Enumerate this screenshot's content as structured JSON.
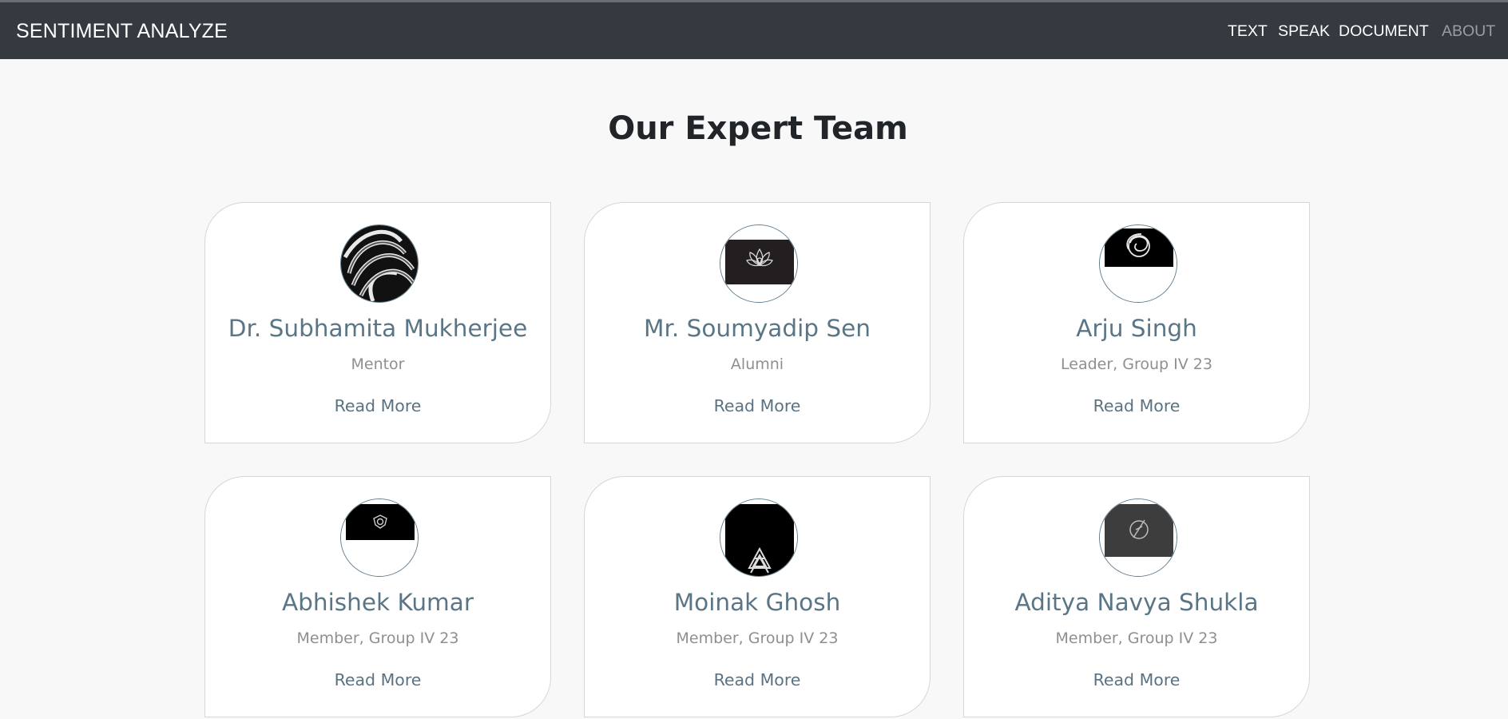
{
  "navbar": {
    "brand": "SENTIMENT ANALYZE",
    "items": [
      {
        "label": "TEXT"
      },
      {
        "label": "SPEAK"
      },
      {
        "label": "DOCUMENT"
      },
      {
        "label": "ABOUT"
      }
    ]
  },
  "page": {
    "title": "Our Expert Team"
  },
  "team": [
    {
      "name": "Dr. Subhamita Mukherjee",
      "role": "Mentor",
      "link": "Read More",
      "avatar_icon": "knot-logo-icon"
    },
    {
      "name": "Mr. Soumyadip Sen",
      "role": "Alumni",
      "link": "Read More",
      "avatar_icon": "lotus-logo-icon"
    },
    {
      "name": "Arju Singh",
      "role": "Leader, Group IV 23",
      "link": "Read More",
      "avatar_icon": "swirl-logo-icon"
    },
    {
      "name": "Abhishek Kumar",
      "role": "Member, Group IV 23",
      "link": "Read More",
      "avatar_icon": "crest-logo-icon"
    },
    {
      "name": "Moinak Ghosh",
      "role": "Member, Group IV 23",
      "link": "Read More",
      "avatar_icon": "triangle-logo-icon"
    },
    {
      "name": "Aditya Navya Shukla",
      "role": "Member, Group IV 23",
      "link": "Read More",
      "avatar_icon": "circle-slash-logo-icon"
    }
  ],
  "colors": {
    "navbar_bg": "#343a40",
    "name_text": "#5a7686",
    "link_text": "#5a7282"
  }
}
